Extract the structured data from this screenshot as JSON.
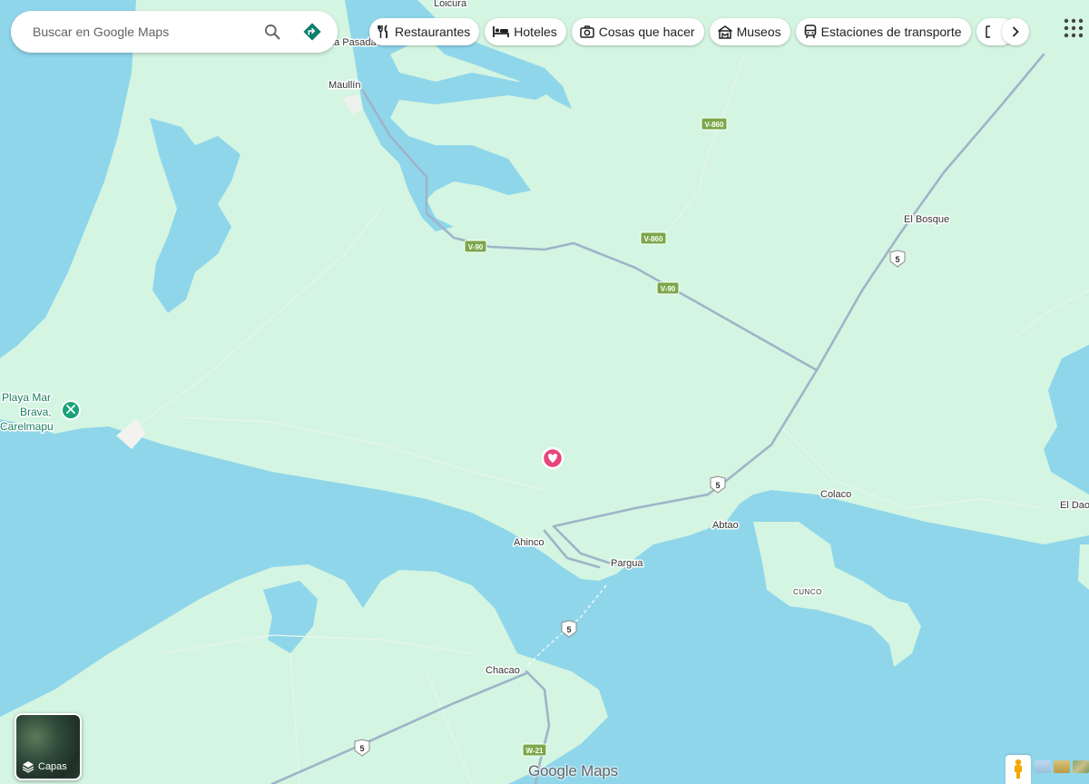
{
  "search": {
    "placeholder": "Buscar en Google Maps"
  },
  "chips": [
    {
      "label": "Restaurantes",
      "icon": "restaurant-icon"
    },
    {
      "label": "Hoteles",
      "icon": "hotel-icon"
    },
    {
      "label": "Cosas que hacer",
      "icon": "camera-icon"
    },
    {
      "label": "Museos",
      "icon": "museum-icon"
    },
    {
      "label": "Estaciones de transporte",
      "icon": "transit-icon"
    }
  ],
  "places": {
    "loicura": "Loicura",
    "la_pasada": "La Pasada",
    "maullin": "Maullín",
    "el_bosque": "El Bosque",
    "playa_line1": "Playa Mar",
    "playa_line2": "Brava,",
    "playa_line3": "Carelmapu",
    "colaco": "Colaco",
    "el_dao": "El Dao",
    "abtao": "Abtao",
    "ahinco": "Ahinco",
    "pargua": "Pargua",
    "cunco": "CUNCO",
    "chacao": "Chacao"
  },
  "roads": {
    "v860": "V-860",
    "v90": "V-90",
    "r5": "5",
    "w21": "W-21"
  },
  "layers": {
    "label": "Capas"
  },
  "branding": {
    "logo": "Google Maps"
  },
  "colors": {
    "water": "#8fd6ea",
    "land": "#d4f5e2",
    "highway": "#9fb4c8",
    "saved_pin": "#e8457a",
    "poi": "#1aa37a"
  }
}
